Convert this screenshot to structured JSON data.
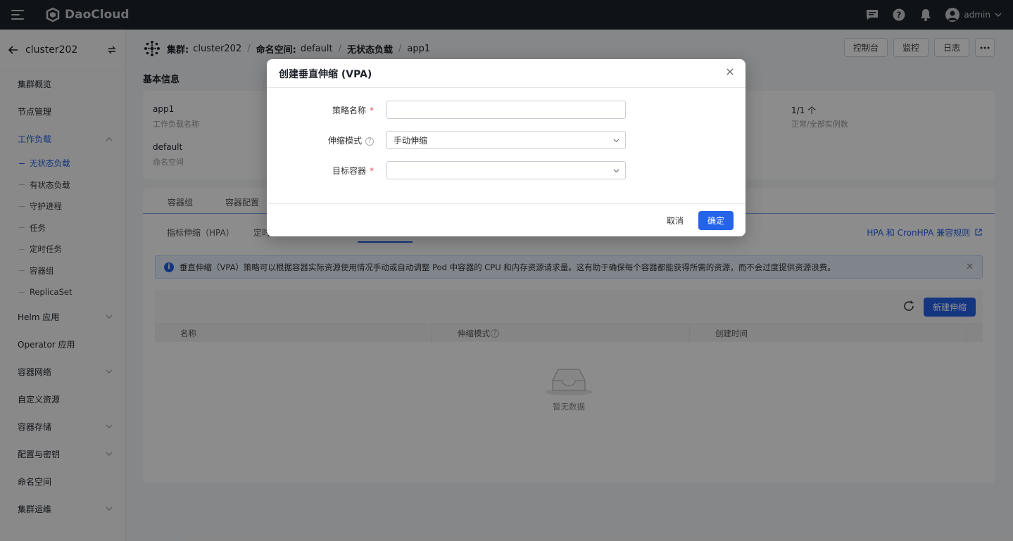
{
  "app": {
    "brand": "DaoCloud",
    "user": "admin"
  },
  "sidebar": {
    "cluster": "cluster202",
    "items": [
      {
        "label": "集群概览"
      },
      {
        "label": "节点管理"
      },
      {
        "label": "工作负载"
      },
      {
        "label": "Helm 应用"
      },
      {
        "label": "Operator 应用"
      },
      {
        "label": "容器网络"
      },
      {
        "label": "自定义资源"
      },
      {
        "label": "容器存储"
      },
      {
        "label": "配置与密钥"
      },
      {
        "label": "命名空间"
      },
      {
        "label": "集群运维"
      }
    ],
    "workload_sub": [
      {
        "label": "无状态负载"
      },
      {
        "label": "有状态负载"
      },
      {
        "label": "守护进程"
      },
      {
        "label": "任务"
      },
      {
        "label": "定时任务"
      },
      {
        "label": "容器组"
      },
      {
        "label": "ReplicaSet"
      }
    ]
  },
  "breadcrumb": {
    "cluster_key": "集群:",
    "cluster": "cluster202",
    "ns_key": "命名空间:",
    "ns": "default",
    "type": "无状态负载",
    "app": "app1"
  },
  "header_actions": {
    "console": "控制台",
    "monitor": "监控",
    "logs": "日志"
  },
  "basic_info": {
    "title": "基本信息",
    "name_value": "app1",
    "name_key": "工作负载名称",
    "ns_value": "default",
    "ns_key": "命名空间",
    "replicas_value": "1/1 个",
    "replicas_key": "正常/全部实例数"
  },
  "tabs": {
    "pods": "容器组",
    "config": "容器配置"
  },
  "subtabs": {
    "hpa": "指标伸缩（HPA）",
    "cron": "定时"
  },
  "hpa_link": "HPA 和 CronHPA 兼容规则",
  "alert": "垂直伸缩（VPA）策略可以根据容器实际资源使用情况手动或自动调整 Pod 中容器的 CPU 和内存资源请求量。这有助于确保每个容器都能获得所需的资源，而不会过度提供资源浪费。",
  "table": {
    "create_button": "新建伸缩",
    "columns": [
      "名称",
      "伸缩模式",
      "创建时间"
    ],
    "empty": "暂无数据"
  },
  "modal": {
    "title": "创建垂直伸缩 (VPA)",
    "policy_name_label": "策略名称",
    "policy_name_value": "",
    "mode_label": "伸缩模式",
    "mode_value": "手动伸缩",
    "container_label": "目标容器",
    "container_value": "",
    "required_mark": "*",
    "help_mark": "?",
    "cancel": "取消",
    "confirm": "确定"
  }
}
